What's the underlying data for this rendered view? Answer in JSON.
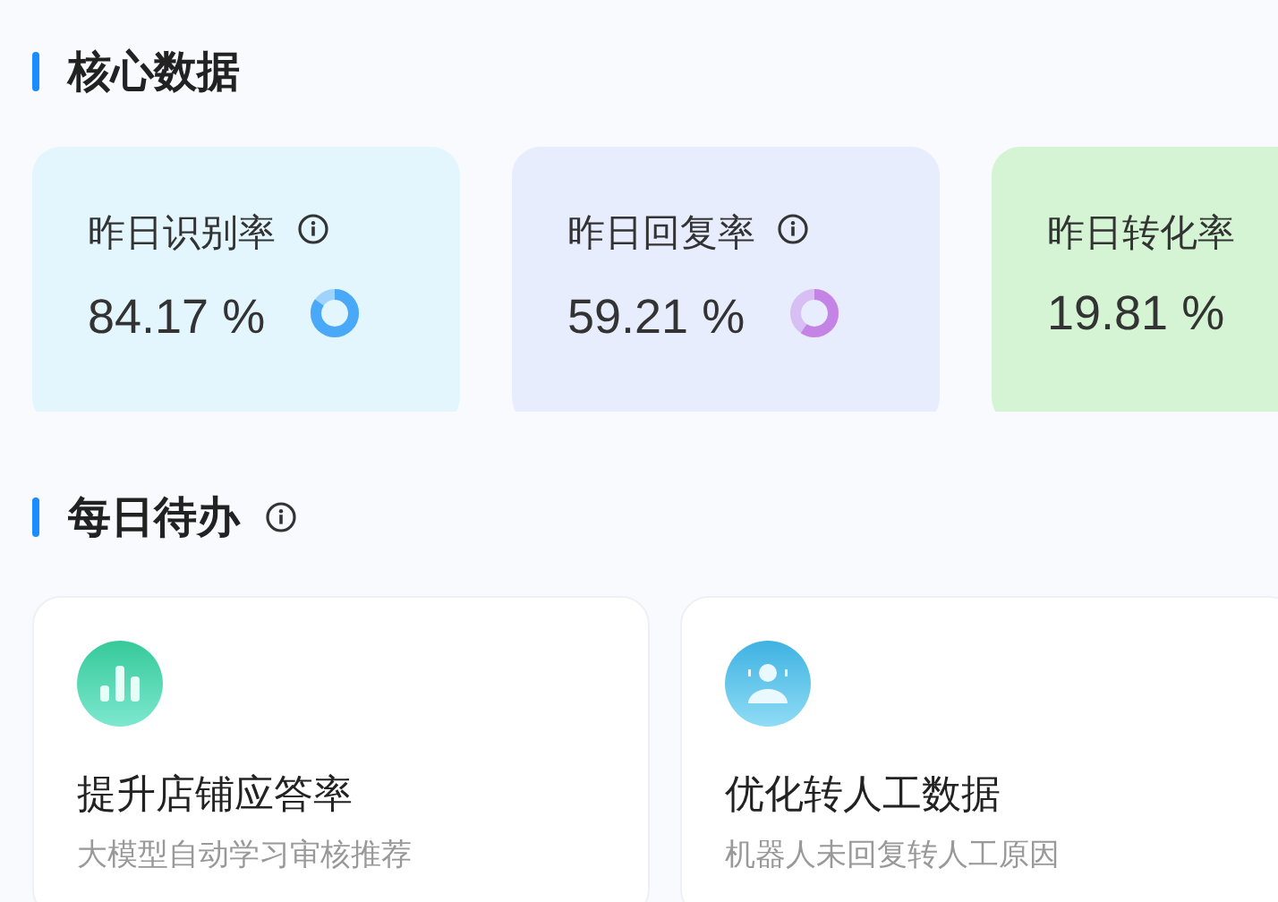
{
  "core_section": {
    "title": "核心数据",
    "info": false
  },
  "metrics": [
    {
      "label": "昨日识别率",
      "info": true,
      "value": "84.17 %",
      "level": 0.8417,
      "color": "#4aa8f8",
      "kind": "blue"
    },
    {
      "label": "昨日回复率",
      "info": true,
      "value": "59.21 %",
      "level": 0.5921,
      "color": "#c484e6",
      "kind": "purple"
    },
    {
      "label": "昨日转化率",
      "info": false,
      "value": "19.81 %",
      "kind": "green"
    }
  ],
  "todo_section": {
    "title": "每日待办",
    "info": true
  },
  "todos": [
    {
      "kind": "chart",
      "title": "提升店铺应答率",
      "subtitle": "大模型自动学习审核推荐"
    },
    {
      "kind": "agent",
      "title": "优化转人工数据",
      "subtitle": "机器人未回复转人工原因"
    }
  ]
}
